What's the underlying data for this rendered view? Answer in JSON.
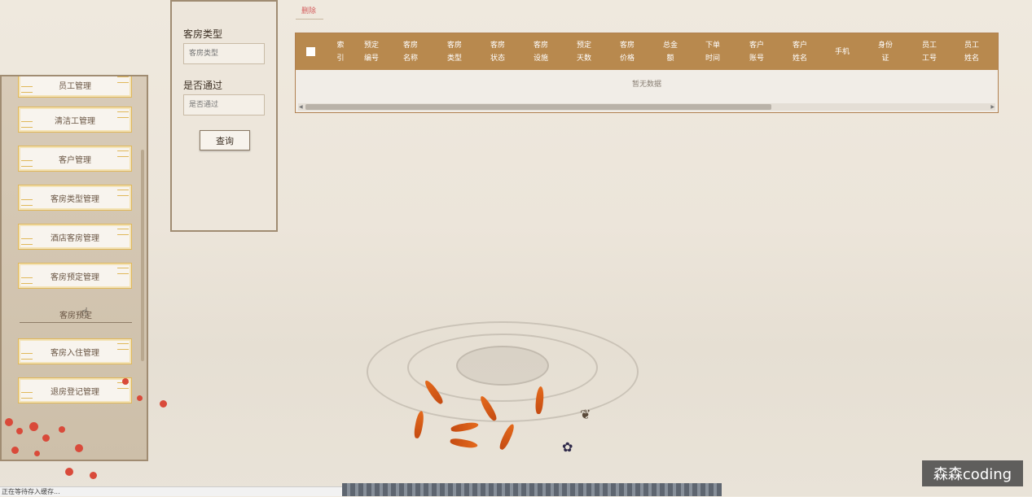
{
  "sidebar": {
    "items": [
      {
        "label": "员工管理"
      },
      {
        "label": "清洁工管理"
      },
      {
        "label": "客户管理"
      },
      {
        "label": "客房类型管理"
      },
      {
        "label": "酒店客房管理"
      },
      {
        "label": "客房预定管理"
      }
    ],
    "section_label": "客房预定",
    "items_after": [
      {
        "label": "客房入住管理"
      },
      {
        "label": "退房登记管理"
      }
    ]
  },
  "search": {
    "room_type_label": "客房类型",
    "room_type_placeholder": "客房类型",
    "approved_label": "是否通过",
    "approved_placeholder": "是否通过",
    "query_button": "查询"
  },
  "toolbar": {
    "delete_label": "删除"
  },
  "table": {
    "columns": [
      "索引",
      "预定编号",
      "客房名称",
      "客房类型",
      "客房状态",
      "客房设施",
      "预定天数",
      "客房价格",
      "总金额",
      "下单时间",
      "客户账号",
      "客户姓名",
      "手机",
      "身份证",
      "员工工号",
      "员工姓名"
    ],
    "columns_wrapped": [
      [
        "索",
        "引"
      ],
      [
        "预定",
        "编号"
      ],
      [
        "客房",
        "名称"
      ],
      [
        "客房",
        "类型"
      ],
      [
        "客房",
        "状态"
      ],
      [
        "客房",
        "设施"
      ],
      [
        "预定",
        "天数"
      ],
      [
        "客房",
        "价格"
      ],
      [
        "总金",
        "额"
      ],
      [
        "下单",
        "时间"
      ],
      [
        "客户",
        "账号"
      ],
      [
        "客户",
        "姓名"
      ],
      [
        "手机"
      ],
      [
        "身份",
        "证"
      ],
      [
        "员工",
        "工号"
      ],
      [
        "员工",
        "姓名"
      ]
    ],
    "empty_text": "暂无数据",
    "rows": []
  },
  "status_bar": {
    "text": "正在等待存入缓存..."
  },
  "watermark": {
    "text": "森森coding"
  },
  "colors": {
    "table_header": "#b8894e",
    "accent_border": "#e0b85a",
    "delete_link": "#d46060"
  }
}
